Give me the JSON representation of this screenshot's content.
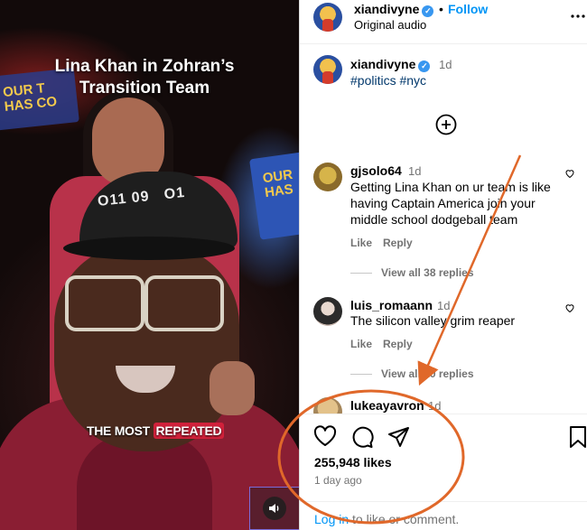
{
  "video": {
    "caption_line1": "Lina Khan in Zohran’s",
    "caption_line2": "Transition Team",
    "subtitle_prefix": "THE MOST ",
    "subtitle_highlight": "REPEATED",
    "sign_left_text": "OUR T\nHAS CO",
    "sign_right_text": "OUR\nHAS",
    "cap_text": "O11 09   O1",
    "mute_icon": "speaker-icon"
  },
  "header": {
    "username": "xiandivyne",
    "separator": "•",
    "follow_label": "Follow",
    "audio_label": "Original audio",
    "more_icon": "more-horizontal-icon"
  },
  "post": {
    "username": "xiandivyne",
    "time": "1d",
    "hashtags": "#politics #nyc",
    "load_more_icon": "plus-circle-icon"
  },
  "comments": [
    {
      "username": "gjsolo64",
      "time": "1d",
      "text": "Getting Lina Khan on ur team is like having Captain America join your middle school dodgeball team",
      "like_label": "Like",
      "reply_label": "Reply",
      "view_replies": "View all 38 replies"
    },
    {
      "username": "luis_romaann",
      "time": "1d",
      "text": "The silicon valley grim reaper",
      "like_label": "Like",
      "reply_label": "Reply",
      "view_replies": "View all 10 replies"
    },
    {
      "username": "lukeayavron",
      "time": "1d"
    }
  ],
  "actions": {
    "like_icon": "heart-icon",
    "comment_icon": "comment-icon",
    "share_icon": "send-icon",
    "save_icon": "bookmark-icon",
    "likes": "255,948 likes",
    "posted": "1 day ago"
  },
  "login": {
    "link": "Log in",
    "rest": " to like or comment."
  },
  "colors": {
    "accent": "#0095f6",
    "annotation": "#e0682a",
    "hoodie": "#8a1e33"
  }
}
